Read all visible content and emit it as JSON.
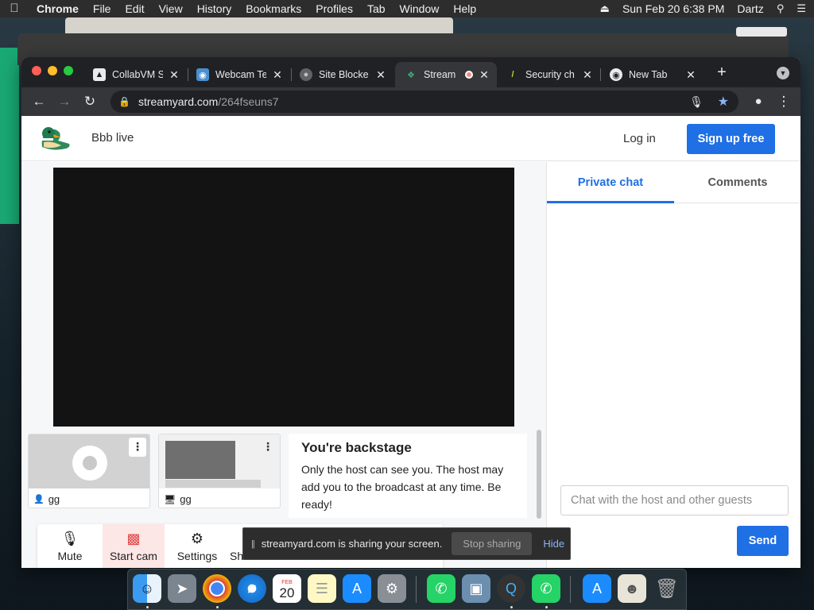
{
  "menubar": {
    "app": "Chrome",
    "items": [
      "File",
      "Edit",
      "View",
      "History",
      "Bookmarks",
      "Profiles",
      "Tab",
      "Window",
      "Help"
    ],
    "clock": "Sun Feb 20  6:38 PM",
    "user": "Dartz"
  },
  "tabs": [
    {
      "label": "CollabVM S"
    },
    {
      "label": "Webcam Te"
    },
    {
      "label": "Site Blocke"
    },
    {
      "label": "Stream"
    },
    {
      "label": "Security ch"
    },
    {
      "label": "New Tab"
    }
  ],
  "address": {
    "host": "streamyard.com",
    "path": "/264fseuns7"
  },
  "site": {
    "studio_title": "Bbb live",
    "login": "Log in",
    "signup": "Sign up free"
  },
  "participants": [
    {
      "name": "gg"
    },
    {
      "name": "gg"
    }
  ],
  "backstage": {
    "title": "You're backstage",
    "text": "Only the host can see you. The host may add you to the broadcast at any time. Be ready!"
  },
  "controls": {
    "mute": "Mute",
    "start_cam": "Start cam",
    "settings": "Settings",
    "share": "Sh"
  },
  "chat": {
    "tab_private": "Private chat",
    "tab_comments": "Comments",
    "placeholder": "Chat with the host and other guests",
    "send": "Send"
  },
  "share_bar": {
    "message": "streamyard.com is sharing your screen.",
    "stop": "Stop sharing",
    "hide": "Hide"
  },
  "dock": {
    "calendar_month": "FEB",
    "calendar_day": "20"
  },
  "colors": {
    "brand_blue": "#1f6fe5",
    "cam_off_red": "#e24848"
  }
}
